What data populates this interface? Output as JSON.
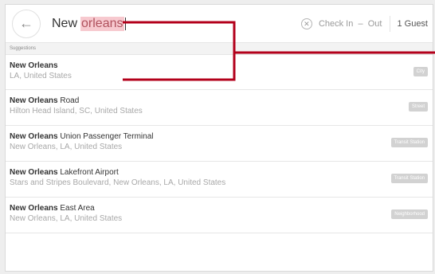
{
  "search": {
    "back_icon": "arrow-left-icon",
    "query_plain": "New",
    "query_highlight": "orleans",
    "clear_icon": "close-circle-icon",
    "check_in": "Check In",
    "dash": "–",
    "check_out": "Out",
    "guests": "1 Guest"
  },
  "suggestions": {
    "label": "Suggestions",
    "items": [
      {
        "bold": "New Orleans",
        "rest": "",
        "sub": "LA, United States",
        "badge": "City"
      },
      {
        "bold": "New Orleans",
        "rest": " Road",
        "sub": "Hilton Head Island, SC, United States",
        "badge": "Street"
      },
      {
        "bold": "New Orleans",
        "rest": " Union Passenger Terminal",
        "sub": "New Orleans, LA, United States",
        "badge": "Transit Station"
      },
      {
        "bold": "New Orleans",
        "rest": " Lakefront Airport",
        "sub": "Stars and Stripes Boulevard, New Orleans, LA, United States",
        "badge": "Transit Station"
      },
      {
        "bold": "New Orleans",
        "rest": " East Area",
        "sub": "New Orleans, LA, United States",
        "badge": "Neighborhood"
      }
    ]
  },
  "colors": {
    "highlight_bg": "#f7c9cf",
    "callout": "#b3001b",
    "badge_bg": "#d2d2d2"
  }
}
